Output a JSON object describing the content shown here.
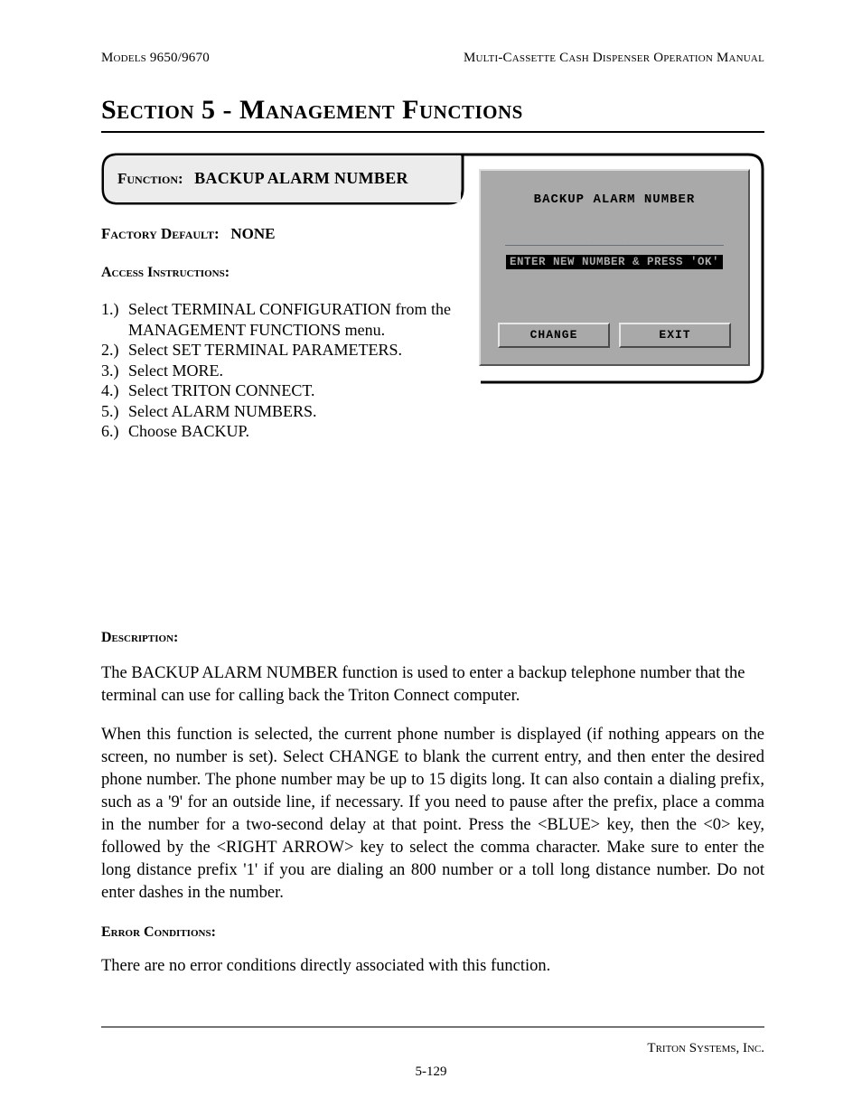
{
  "header": {
    "left": "Models 9650/9670",
    "right": "Multi-Cassette Cash Dispenser Operation Manual"
  },
  "section_title": "Section 5 - Management Functions",
  "function_box": {
    "label": "Function:",
    "name": "BACKUP ALARM NUMBER"
  },
  "screen": {
    "title": "BACKUP ALARM NUMBER",
    "input_line": "_______________________________",
    "prompt": "ENTER NEW NUMBER & PRESS 'OK'",
    "buttons": {
      "change": "CHANGE",
      "exit": "EXIT"
    }
  },
  "factory_default": {
    "label": "Factory Default:",
    "value": "NONE"
  },
  "access_instructions_label": "Access Instructions:",
  "steps": [
    "Select TERMINAL CONFIGURATION from the MANAGEMENT FUNCTIONS menu.",
    "Select SET TERMINAL PARAMETERS.",
    "Select MORE.",
    "Select TRITON CONNECT.",
    "Select ALARM NUMBERS.",
    "Choose BACKUP."
  ],
  "description_label": "Description:",
  "description_paras": [
    "The BACKUP ALARM NUMBER function is used to enter a backup telephone number that the terminal can use for calling back the Triton Connect computer.",
    "When this function is selected, the current phone number is displayed (if nothing appears on the screen, no number is set).  Select CHANGE to blank the current entry, and then enter the desired phone number.  The phone number may be up to 15 digits long.  It can also contain a dialing prefix, such as a '9' for an outside line, if necessary.  If you need to pause after the prefix, place a comma in the number for a two-second delay at that point.  Press the <BLUE> key, then the <0> key, followed by the <RIGHT ARROW> key to select the comma character.  Make sure to enter the long distance prefix '1' if you are dialing an 800 number or a toll long distance number.  Do not enter dashes in the number."
  ],
  "error_label": "Error Conditions:",
  "error_text": "There are no error conditions directly associated with this function.",
  "footer": {
    "company": "Triton Systems, Inc.",
    "page": "5-129"
  }
}
